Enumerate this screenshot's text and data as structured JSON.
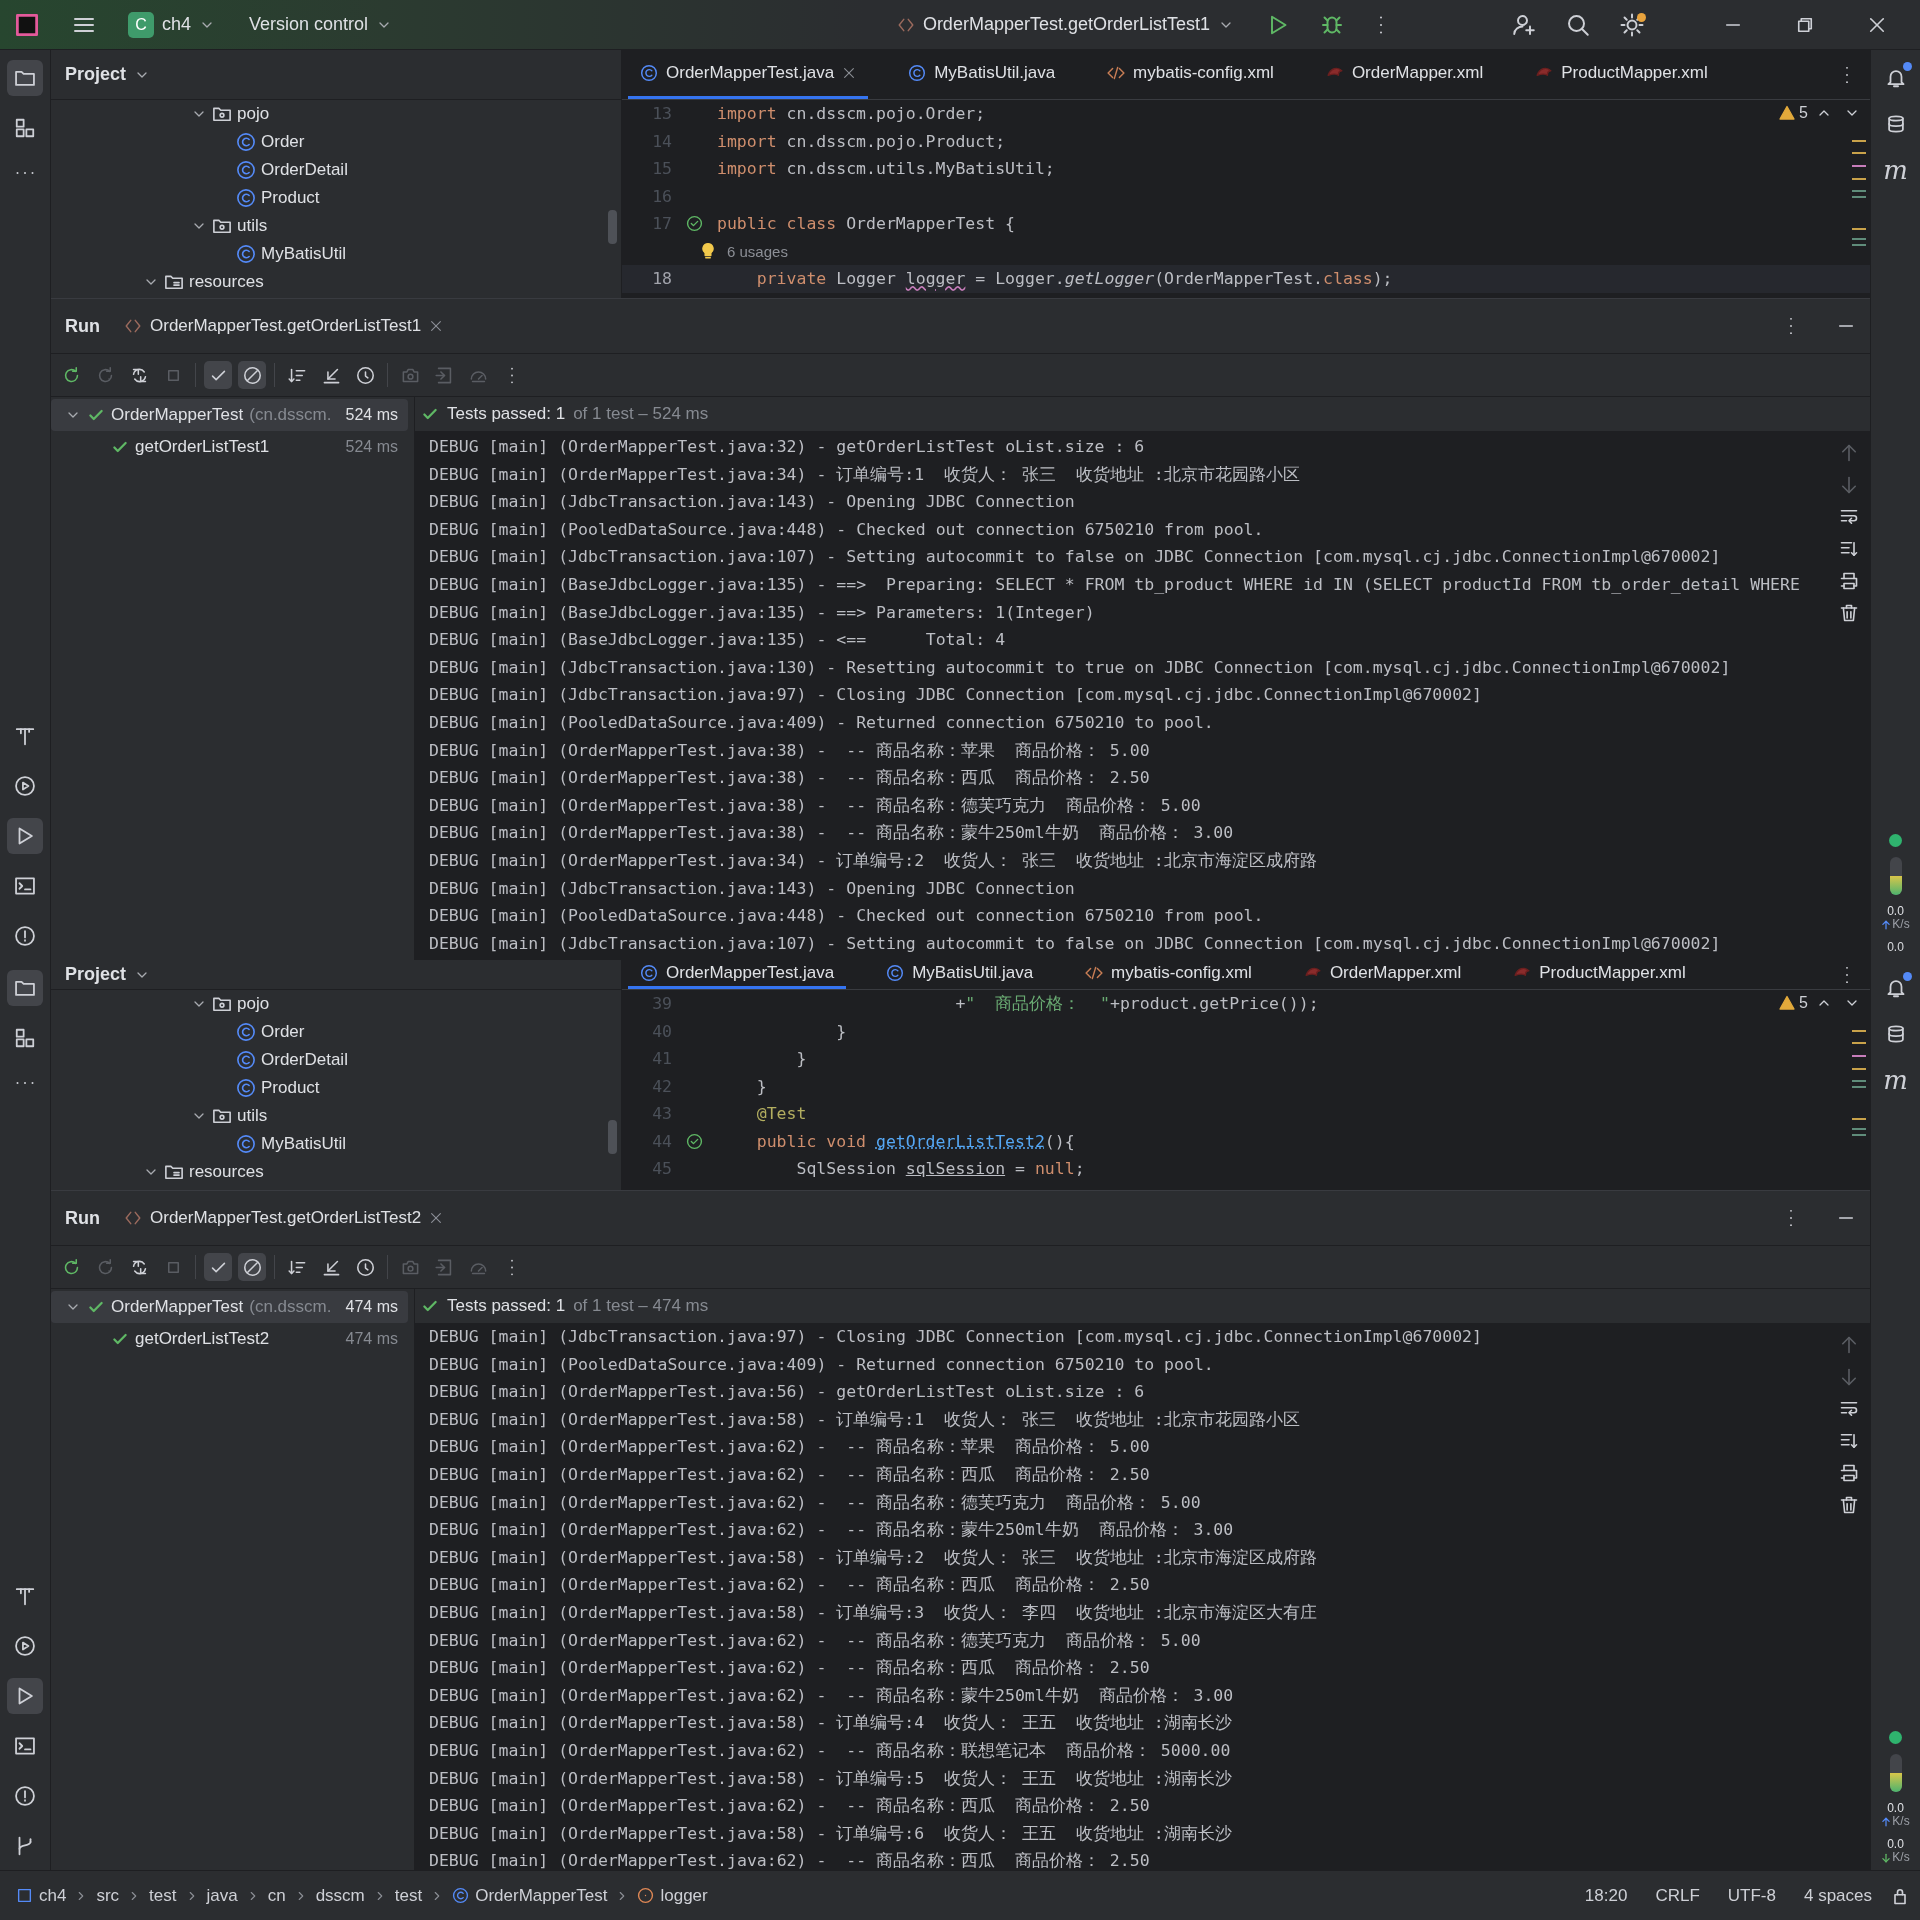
{
  "title_bar": {
    "project_initial": "C",
    "project": "ch4",
    "vcs": "Version control",
    "run_config": "OrderMapperTest.getOrderListTest1",
    "settings_badge": true
  },
  "panes": [
    {
      "left_stripe": {
        "top": [
          {
            "kind": "project",
            "selected": true
          },
          {
            "kind": "structure",
            "selected": false
          },
          {
            "kind": "more",
            "selected": false
          }
        ],
        "bottom": [
          {
            "kind": "build",
            "selected": false
          },
          {
            "kind": "services",
            "selected": false
          },
          {
            "kind": "run",
            "selected": true
          },
          {
            "kind": "terminal",
            "selected": false
          },
          {
            "kind": "problems",
            "selected": false
          }
        ]
      },
      "project": {
        "title": "Project",
        "tree": [
          {
            "kind": "offscreen",
            "children": [
              {
                "kind": "offscreen",
                "children": [
                  {
                    "kind": "package",
                    "label": "pojo",
                    "expanded": true,
                    "children": [
                      {
                        "kind": "class",
                        "label": "Order"
                      },
                      {
                        "kind": "class",
                        "label": "OrderDetail"
                      },
                      {
                        "kind": "class",
                        "label": "Product"
                      }
                    ]
                  },
                  {
                    "kind": "package",
                    "label": "utils",
                    "expanded": true,
                    "children": [
                      {
                        "kind": "class",
                        "label": "MyBatisUtil"
                      }
                    ]
                  }
                ]
              }
            ]
          },
          {
            "kind": "resources",
            "label": "resources",
            "expanded": true
          }
        ]
      },
      "editor": {
        "tabs": [
          {
            "label": "OrderMapperTest.java",
            "kind": "class",
            "selected": true,
            "closable": true
          },
          {
            "label": "MyBatisUtil.java",
            "kind": "class",
            "selected": false,
            "closable": false
          },
          {
            "label": "mybatis-config.xml",
            "kind": "xml",
            "selected": false,
            "closable": false
          },
          {
            "label": "OrderMapper.xml",
            "kind": "mybatis",
            "selected": false,
            "closable": false
          },
          {
            "label": "ProductMapper.xml",
            "kind": "mybatis",
            "selected": false,
            "closable": false
          }
        ],
        "warnings": "5",
        "lines": [
          {
            "kind": "code",
            "number": "13",
            "run_gutter": false,
            "current": false,
            "tokens": [
              {
                "kind": "keyword",
                "text": "import"
              },
              {
                "kind": "plain",
                "text": " cn.dsscm.pojo.Order;"
              }
            ]
          },
          {
            "kind": "code",
            "number": "14",
            "run_gutter": false,
            "current": false,
            "tokens": [
              {
                "kind": "keyword",
                "text": "import"
              },
              {
                "kind": "plain",
                "text": " cn.dsscm.pojo.Product;"
              }
            ]
          },
          {
            "kind": "code",
            "number": "15",
            "run_gutter": false,
            "current": false,
            "tokens": [
              {
                "kind": "keyword",
                "text": "import"
              },
              {
                "kind": "plain",
                "text": " cn.dsscm.utils.MyBatisUtil;"
              }
            ]
          },
          {
            "kind": "code",
            "number": "16",
            "run_gutter": false,
            "current": false
          },
          {
            "kind": "code",
            "number": "17",
            "run_gutter": true,
            "current": false,
            "tokens": [
              {
                "kind": "keyword",
                "text": "public class"
              },
              {
                "kind": "plain",
                "text": " OrderMapperTest {"
              }
            ]
          },
          {
            "kind": "hint",
            "text": "6 usages"
          },
          {
            "kind": "code",
            "number": "18",
            "run_gutter": false,
            "current": true,
            "tokens": [
              {
                "kind": "keyword",
                "text": "    private"
              },
              {
                "kind": "plain",
                "text": " Logger "
              },
              {
                "kind": "warn",
                "text": "logger"
              },
              {
                "kind": "plain",
                "text": " = Logger."
              },
              {
                "kind": "static",
                "text": "getLogger"
              },
              {
                "kind": "plain",
                "text": "(OrderMapperTest."
              },
              {
                "kind": "keyword",
                "text": "class"
              },
              {
                "kind": "plain",
                "text": ");"
              }
            ]
          }
        ]
      },
      "run": {
        "title": "Run",
        "tab": "OrderMapperTest.getOrderListTest1",
        "toolbar": [
          {
            "kind": "rerun",
            "on": false,
            "disabled": false
          },
          {
            "kind": "rerun-failed",
            "on": false,
            "disabled": true
          },
          {
            "kind": "toggle-auto",
            "on": false,
            "disabled": false
          },
          {
            "kind": "stop",
            "on": false,
            "disabled": true
          },
          {
            "kind": "check",
            "on": true,
            "disabled": false
          },
          {
            "kind": "ignored",
            "on": true,
            "disabled": false
          },
          {
            "kind": "sort",
            "on": false,
            "disabled": false
          },
          {
            "kind": "collapse",
            "on": false,
            "disabled": false
          },
          {
            "kind": "clock",
            "on": false,
            "disabled": false
          },
          {
            "kind": "camera",
            "on": false,
            "disabled": true
          },
          {
            "kind": "import",
            "on": false,
            "disabled": true
          },
          {
            "kind": "gauge",
            "on": false,
            "disabled": true
          },
          {
            "kind": "vmore",
            "on": false,
            "disabled": false
          }
        ],
        "tests": [
          {
            "label": "OrderMapperTest",
            "package": "(cn.dsscm.",
            "time": "524 ms",
            "passed": true,
            "expanded": true,
            "selected": true,
            "children": [
              {
                "label": "getOrderListTest1",
                "time": "524 ms",
                "passed": true,
                "selected": false
              }
            ]
          }
        ],
        "summary": {
          "main": "Tests passed: 1",
          "detail": "of 1 test – 524 ms"
        },
        "console": [
          "DEBUG [main] (OrderMapperTest.java:32) - getOrderListTest oList.size : 6",
          "DEBUG [main] (OrderMapperTest.java:34) - 订单编号:1  收货人： 张三  收货地址 :北京市花园路小区",
          "DEBUG [main] (JdbcTransaction.java:143) - Opening JDBC Connection",
          "DEBUG [main] (PooledDataSource.java:448) - Checked out connection 6750210 from pool.",
          "DEBUG [main] (JdbcTransaction.java:107) - Setting autocommit to false on JDBC Connection [com.mysql.cj.jdbc.ConnectionImpl@670002]",
          "DEBUG [main] (BaseJdbcLogger.java:135) - ==>  Preparing: SELECT * FROM tb_product WHERE id IN (SELECT productId FROM tb_order_detail WHERE",
          "DEBUG [main] (BaseJdbcLogger.java:135) - ==> Parameters: 1(Integer)",
          "DEBUG [main] (BaseJdbcLogger.java:135) - <==      Total: 4",
          "DEBUG [main] (JdbcTransaction.java:130) - Resetting autocommit to true on JDBC Connection [com.mysql.cj.jdbc.ConnectionImpl@670002]",
          "DEBUG [main] (JdbcTransaction.java:97) - Closing JDBC Connection [com.mysql.cj.jdbc.ConnectionImpl@670002]",
          "DEBUG [main] (PooledDataSource.java:409) - Returned connection 6750210 to pool.",
          "DEBUG [main] (OrderMapperTest.java:38) -  -- 商品名称：苹果  商品价格： 5.00",
          "DEBUG [main] (OrderMapperTest.java:38) -  -- 商品名称：西瓜  商品价格： 2.50",
          "DEBUG [main] (OrderMapperTest.java:38) -  -- 商品名称：德芙巧克力  商品价格： 5.00",
          "DEBUG [main] (OrderMapperTest.java:38) -  -- 商品名称：蒙牛250ml牛奶  商品价格： 3.00",
          "DEBUG [main] (OrderMapperTest.java:34) - 订单编号:2  收货人： 张三  收货地址 :北京市海淀区成府路",
          "DEBUG [main] (JdbcTransaction.java:143) - Opening JDBC Connection",
          "DEBUG [main] (PooledDataSource.java:448) - Checked out connection 6750210 from pool.",
          "DEBUG [main] (JdbcTransaction.java:107) - Setting autocommit to false on JDBC Connection [com.mysql.cj.jdbc.ConnectionImpl@670002]"
        ]
      },
      "right_stripe": {
        "notification_badge": true,
        "maven_label": "m",
        "memory": {
          "level": 0.5
        },
        "net": [
          {
            "value": "0.0",
            "unit": "K/s",
            "kind": "upload"
          },
          {
            "value": "0.0",
            "kind": "plain"
          }
        ]
      }
    },
    {
      "left_stripe": {
        "top": [
          {
            "kind": "project",
            "selected": true
          },
          {
            "kind": "structure",
            "selected": false
          },
          {
            "kind": "more",
            "selected": false
          }
        ],
        "bottom": [
          {
            "kind": "build",
            "selected": false
          },
          {
            "kind": "services",
            "selected": false
          },
          {
            "kind": "run",
            "selected": true
          },
          {
            "kind": "terminal",
            "selected": false
          },
          {
            "kind": "problems",
            "selected": false
          },
          {
            "kind": "git",
            "selected": false
          }
        ]
      },
      "project": {
        "title": "Project",
        "tree": [
          {
            "kind": "offscreen",
            "children": [
              {
                "kind": "offscreen",
                "children": [
                  {
                    "kind": "package",
                    "label": "pojo",
                    "expanded": true,
                    "children": [
                      {
                        "kind": "class",
                        "label": "Order"
                      },
                      {
                        "kind": "class",
                        "label": "OrderDetail"
                      },
                      {
                        "kind": "class",
                        "label": "Product"
                      }
                    ]
                  },
                  {
                    "kind": "package",
                    "label": "utils",
                    "expanded": true,
                    "children": [
                      {
                        "kind": "class",
                        "label": "MyBatisUtil"
                      }
                    ]
                  }
                ]
              }
            ]
          },
          {
            "kind": "resources",
            "label": "resources",
            "expanded": true
          }
        ]
      },
      "editor": {
        "tabs": [
          {
            "label": "OrderMapperTest.java",
            "kind": "class",
            "selected": true,
            "closable": false
          },
          {
            "label": "MyBatisUtil.java",
            "kind": "class",
            "selected": false,
            "closable": false
          },
          {
            "label": "mybatis-config.xml",
            "kind": "xml",
            "selected": false,
            "closable": false
          },
          {
            "label": "OrderMapper.xml",
            "kind": "mybatis",
            "selected": false,
            "closable": false
          },
          {
            "label": "ProductMapper.xml",
            "kind": "mybatis",
            "selected": false,
            "closable": false
          }
        ],
        "warnings": "5",
        "lines": [
          {
            "kind": "code",
            "number": "39",
            "run_gutter": false,
            "current": false,
            "tokens": [
              {
                "kind": "plain",
                "text": "                        +"
              },
              {
                "kind": "string",
                "text": "\"  商品价格：  \""
              },
              {
                "kind": "plain",
                "text": "+product.getPrice());"
              }
            ]
          },
          {
            "kind": "code",
            "number": "40",
            "run_gutter": false,
            "current": false,
            "tokens": [
              {
                "kind": "plain",
                "text": "            }"
              }
            ]
          },
          {
            "kind": "code",
            "number": "41",
            "run_gutter": false,
            "current": false,
            "tokens": [
              {
                "kind": "plain",
                "text": "        }"
              }
            ]
          },
          {
            "kind": "code",
            "number": "42",
            "run_gutter": false,
            "current": false,
            "tokens": [
              {
                "kind": "plain",
                "text": "    }"
              }
            ]
          },
          {
            "kind": "code",
            "number": "43",
            "run_gutter": false,
            "current": false,
            "tokens": [
              {
                "kind": "annotation",
                "text": "    @Test"
              }
            ]
          },
          {
            "kind": "code",
            "number": "44",
            "run_gutter": true,
            "current": false,
            "tokens": [
              {
                "kind": "keyword",
                "text": "    public void "
              },
              {
                "kind": "method",
                "text": "getOrderListTest2"
              },
              {
                "kind": "plain",
                "text": "(){"
              }
            ]
          },
          {
            "kind": "code",
            "number": "45",
            "run_gutter": false,
            "current": false,
            "tokens": [
              {
                "kind": "plain",
                "text": "        SqlSession "
              },
              {
                "kind": "underlined",
                "text": "sqlSession"
              },
              {
                "kind": "plain",
                "text": " = "
              },
              {
                "kind": "keyword",
                "text": "null"
              },
              {
                "kind": "plain",
                "text": ";"
              }
            ]
          }
        ]
      },
      "run": {
        "title": "Run",
        "tab": "OrderMapperTest.getOrderListTest2",
        "toolbar": [
          {
            "kind": "rerun",
            "on": false,
            "disabled": false
          },
          {
            "kind": "rerun-failed",
            "on": false,
            "disabled": true
          },
          {
            "kind": "toggle-auto",
            "on": false,
            "disabled": false
          },
          {
            "kind": "stop",
            "on": false,
            "disabled": true
          },
          {
            "kind": "check",
            "on": true,
            "disabled": false
          },
          {
            "kind": "ignored",
            "on": true,
            "disabled": false
          },
          {
            "kind": "sort",
            "on": false,
            "disabled": false
          },
          {
            "kind": "collapse",
            "on": false,
            "disabled": false
          },
          {
            "kind": "clock",
            "on": false,
            "disabled": false
          },
          {
            "kind": "camera",
            "on": false,
            "disabled": true
          },
          {
            "kind": "import",
            "on": false,
            "disabled": true
          },
          {
            "kind": "gauge",
            "on": false,
            "disabled": true
          },
          {
            "kind": "vmore",
            "on": false,
            "disabled": false
          }
        ],
        "tests": [
          {
            "label": "OrderMapperTest",
            "package": "(cn.dsscm.",
            "time": "474 ms",
            "passed": true,
            "expanded": true,
            "selected": true,
            "children": [
              {
                "label": "getOrderListTest2",
                "time": "474 ms",
                "passed": true,
                "selected": false
              }
            ]
          }
        ],
        "summary": {
          "main": "Tests passed: 1",
          "detail": "of 1 test – 474 ms"
        },
        "console": [
          "DEBUG [main] (JdbcTransaction.java:97) - Closing JDBC Connection [com.mysql.cj.jdbc.ConnectionImpl@670002]",
          "DEBUG [main] (PooledDataSource.java:409) - Returned connection 6750210 to pool.",
          "DEBUG [main] (OrderMapperTest.java:56) - getOrderListTest oList.size : 6",
          "DEBUG [main] (OrderMapperTest.java:58) - 订单编号:1  收货人： 张三  收货地址 :北京市花园路小区",
          "DEBUG [main] (OrderMapperTest.java:62) -  -- 商品名称：苹果  商品价格： 5.00",
          "DEBUG [main] (OrderMapperTest.java:62) -  -- 商品名称：西瓜  商品价格： 2.50",
          "DEBUG [main] (OrderMapperTest.java:62) -  -- 商品名称：德芙巧克力  商品价格： 5.00",
          "DEBUG [main] (OrderMapperTest.java:62) -  -- 商品名称：蒙牛250ml牛奶  商品价格： 3.00",
          "DEBUG [main] (OrderMapperTest.java:58) - 订单编号:2  收货人： 张三  收货地址 :北京市海淀区成府路",
          "DEBUG [main] (OrderMapperTest.java:62) -  -- 商品名称：西瓜  商品价格： 2.50",
          "DEBUG [main] (OrderMapperTest.java:58) - 订单编号:3  收货人： 李四  收货地址 :北京市海淀区大有庄",
          "DEBUG [main] (OrderMapperTest.java:62) -  -- 商品名称：德芙巧克力  商品价格： 5.00",
          "DEBUG [main] (OrderMapperTest.java:62) -  -- 商品名称：西瓜  商品价格： 2.50",
          "DEBUG [main] (OrderMapperTest.java:62) -  -- 商品名称：蒙牛250ml牛奶  商品价格： 3.00",
          "DEBUG [main] (OrderMapperTest.java:58) - 订单编号:4  收货人： 王五  收货地址 :湖南长沙",
          "DEBUG [main] (OrderMapperTest.java:62) -  -- 商品名称：联想笔记本  商品价格： 5000.00",
          "DEBUG [main] (OrderMapperTest.java:58) - 订单编号:5  收货人： 王五  收货地址 :湖南长沙",
          "DEBUG [main] (OrderMapperTest.java:62) -  -- 商品名称：西瓜  商品价格： 2.50",
          "DEBUG [main] (OrderMapperTest.java:58) - 订单编号:6  收货人： 王五  收货地址 :湖南长沙",
          "DEBUG [main] (OrderMapperTest.java:62) -  -- 商品名称：西瓜  商品价格： 2.50"
        ]
      },
      "right_stripe": {
        "notification_badge": true,
        "maven_label": "m",
        "memory": {
          "level": 0.5
        },
        "net": [
          {
            "value": "0.0",
            "unit": "K/s",
            "kind": "upload"
          },
          {
            "value": "0.0",
            "unit": "K/s",
            "kind": "download"
          }
        ]
      }
    }
  ],
  "status_bar": {
    "crumbs": [
      {
        "kind": "module",
        "text": "ch4"
      },
      {
        "kind": "plain",
        "text": "src"
      },
      {
        "kind": "plain",
        "text": "test"
      },
      {
        "kind": "plain",
        "text": "java"
      },
      {
        "kind": "plain",
        "text": "cn"
      },
      {
        "kind": "plain",
        "text": "dsscm"
      },
      {
        "kind": "plain",
        "text": "test"
      },
      {
        "kind": "class",
        "text": "OrderMapperTest"
      },
      {
        "kind": "field",
        "text": "logger"
      }
    ],
    "items": [
      "18:20",
      "CRLF",
      "UTF-8",
      "4 spaces"
    ]
  }
}
